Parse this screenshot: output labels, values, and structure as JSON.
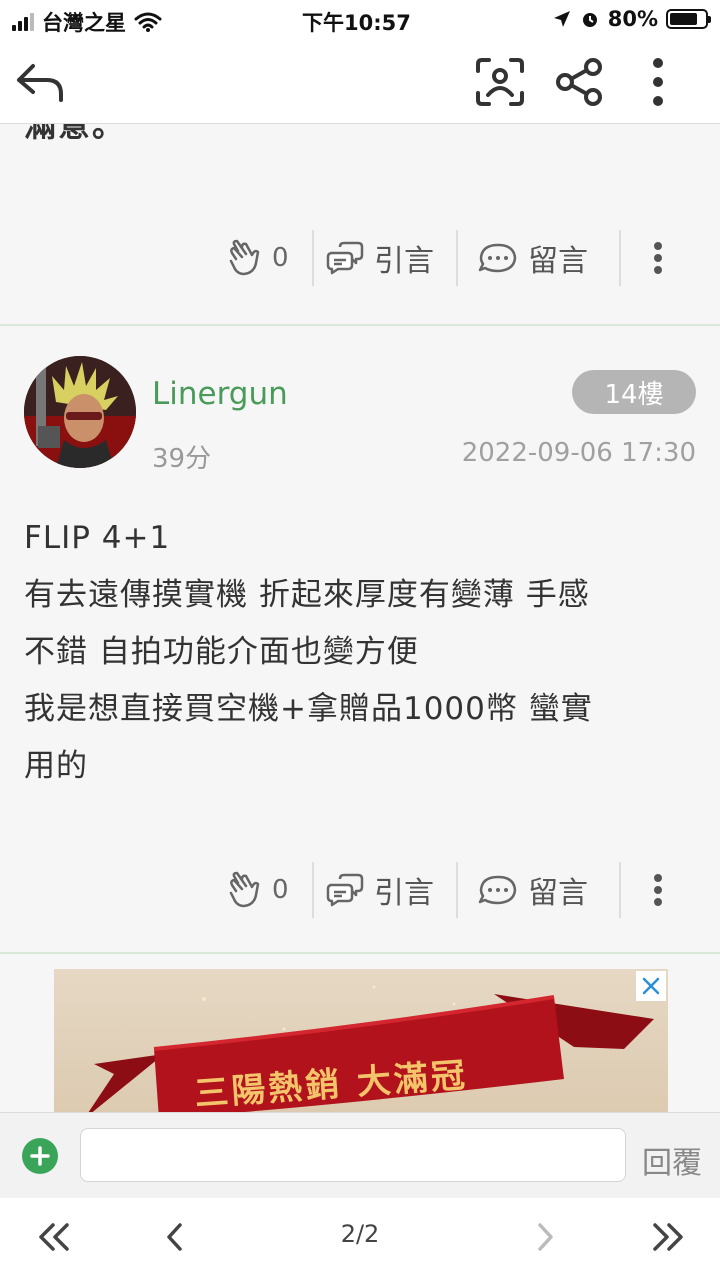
{
  "status_bar": {
    "carrier": "台灣之星",
    "time": "下午10:57",
    "battery": "80%",
    "battery_level": 0.8
  },
  "nav": {
    "back_icon": "back-arrow-icon",
    "scan_icon": "scan-face-icon",
    "share_icon": "share-icon",
    "more_icon": "more-vertical-icon"
  },
  "previous_post": {
    "cut_text": "滿意。",
    "likes": "0",
    "quote_label": "引言",
    "comment_label": "留言"
  },
  "post": {
    "username": "Linergun",
    "score": "39分",
    "floor": "14樓",
    "date": "2022-09-06 17:30",
    "body_lines": [
      "FLIP 4+1",
      "有去遠傳摸實機 折起來厚度有變薄 手感",
      "不錯 自拍功能介面也變方便",
      "我是想直接買空機+拿贈品1000幣 蠻實",
      "用的"
    ],
    "likes": "0",
    "quote_label": "引言",
    "comment_label": "留言"
  },
  "ad": {
    "banner_text": "三陽熱銷 大滿冠",
    "ribbon_color": "#b1121c",
    "text_color": "#f3c46a"
  },
  "reply_bar": {
    "input_placeholder": "",
    "reply_label": "回覆",
    "accent": "#3aa558"
  },
  "pagination": {
    "page_indicator": "2/2"
  }
}
